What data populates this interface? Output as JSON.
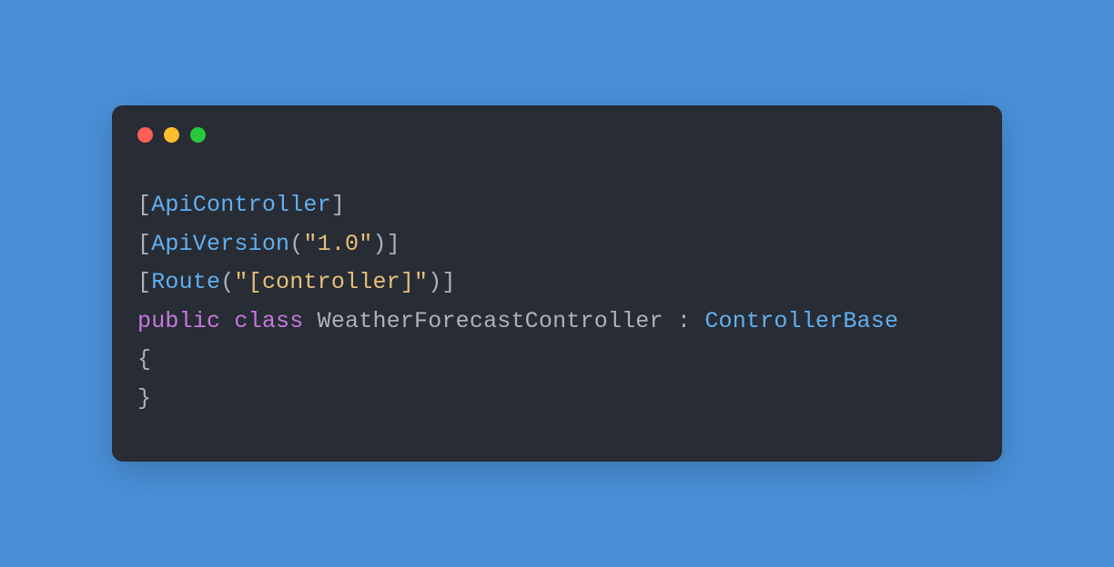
{
  "colors": {
    "background": "#4a90d9",
    "window_bg": "#282c34",
    "dot_red": "#ff5f56",
    "dot_yellow": "#ffbd2e",
    "dot_green": "#27c93f",
    "punct": "#abb2bf",
    "type": "#61afef",
    "string": "#e5c07b",
    "keyword": "#c678dd"
  },
  "code": {
    "line1": {
      "open": "[",
      "attr": "ApiController",
      "close": "]"
    },
    "line2": {
      "open": "[",
      "attr": "ApiVersion",
      "lparen": "(",
      "str": "\"1.0\"",
      "rparen": ")",
      "close": "]"
    },
    "line3": {
      "open": "[",
      "attr": "Route",
      "lparen": "(",
      "str": "\"[controller]\"",
      "rparen": ")",
      "close": "]"
    },
    "line4": {
      "kw_public": "public",
      "sp1": " ",
      "kw_class": "class",
      "sp2": " ",
      "classname": "WeatherForecastController",
      "sp3": " ",
      "colon": ":",
      "sp4": " ",
      "base": "ControllerBase"
    },
    "line5": {
      "brace": "{"
    },
    "line6": {
      "brace": "}"
    }
  }
}
